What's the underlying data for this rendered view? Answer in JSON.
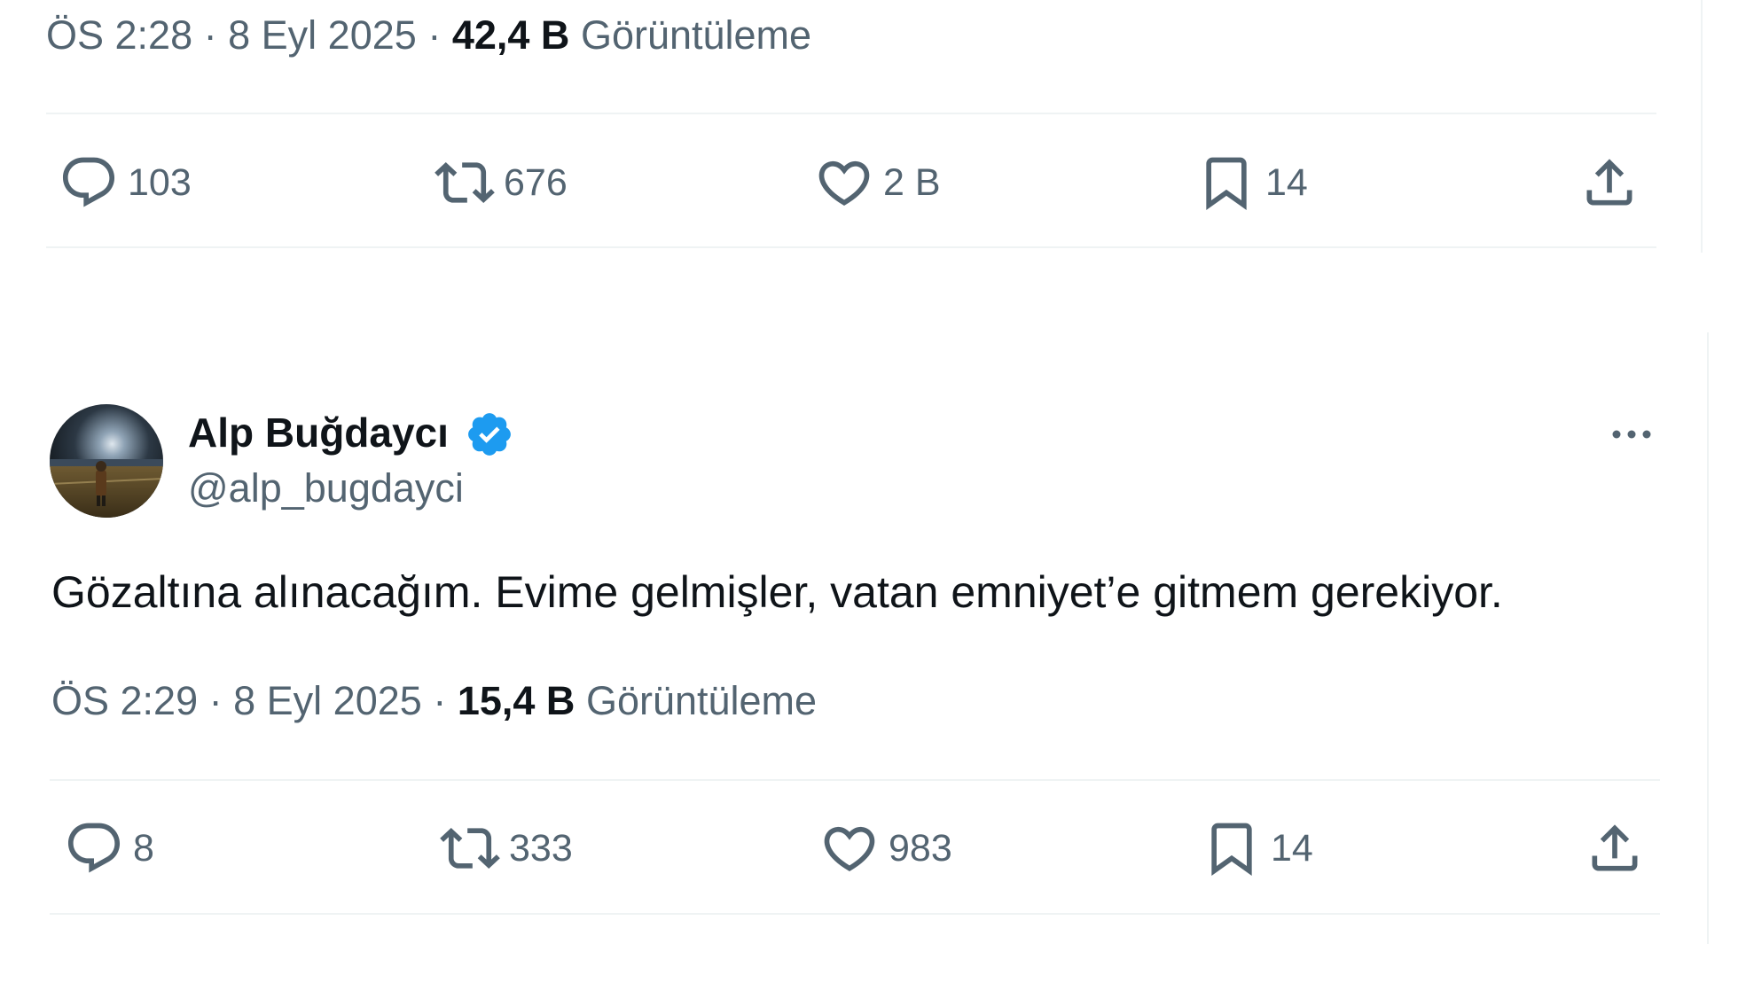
{
  "tweet1": {
    "time": "ÖS 2:28",
    "date": "8 Eyl 2025",
    "views_count": "42,4 B",
    "views_label": "Görüntüleme",
    "replies": "103",
    "reposts": "676",
    "likes": "2 B",
    "bookmarks": "14"
  },
  "tweet2": {
    "author_name": "Alp Buğdaycı",
    "author_handle": "@alp_bugdayci",
    "text": "Gözaltına alınacağım. Evime gelmişler, vatan emniyet’e gitmem gerekiyor.",
    "time": "ÖS 2:29",
    "date": "8 Eyl 2025",
    "views_count": "15,4 B",
    "views_label": "Görüntüleme",
    "replies": "8",
    "reposts": "333",
    "likes": "983",
    "bookmarks": "14"
  },
  "separator": "·",
  "icons": {
    "reply": "reply-icon",
    "repost": "repost-icon",
    "like": "heart-icon",
    "bookmark": "bookmark-icon",
    "share": "share-icon",
    "verified": "verified-badge-icon",
    "more": "more-options-icon"
  },
  "colors": {
    "text_primary": "#0f1419",
    "text_secondary": "#536471",
    "divider": "#eff3f4",
    "verified_blue": "#1d9bf0"
  }
}
